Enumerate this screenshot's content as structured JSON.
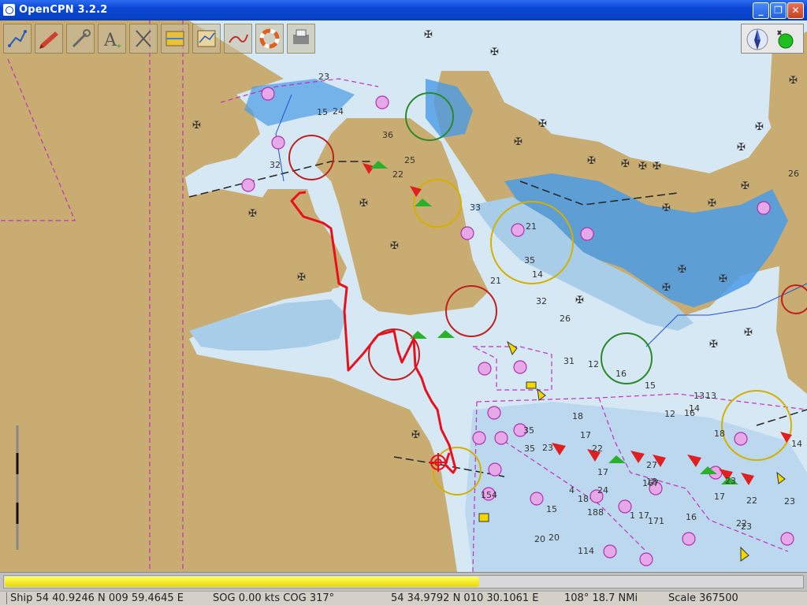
{
  "window": {
    "title": "OpenCPN 3.2.2",
    "minimize_label": "_",
    "maximize_label": "❐",
    "close_label": "✕"
  },
  "toolbar": {
    "buttons": [
      {
        "icon": "route-icon"
      },
      {
        "icon": "ship-icon"
      },
      {
        "icon": "settings-wrench-icon"
      },
      {
        "icon": "text-annotation-icon"
      },
      {
        "icon": "clear-track-icon"
      },
      {
        "icon": "layers-icon"
      },
      {
        "icon": "chart-quilt-icon"
      },
      {
        "icon": "track-icon"
      },
      {
        "icon": "lifebuoy-icon"
      },
      {
        "icon": "print-icon"
      }
    ]
  },
  "compass": {
    "north_icon": "compass-north-icon",
    "gps_status": "gps-ok-icon",
    "gps_color": "#1fbf1f"
  },
  "progress": {
    "fraction": 0.595
  },
  "status": {
    "ship": "Ship 54 40.9246 N   009 59.4645 E",
    "sog_cog": "SOG 0.00 kts   COG 317°",
    "cursor": "54 34.9792 N   010 30.1061 E",
    "bearing_dist": "108°  18.7 NMi",
    "scale": "Scale 367500"
  },
  "chart_labels": {
    "soundings": [
      "23",
      "15",
      "24",
      "36",
      "32",
      "25",
      "22",
      "33",
      "21",
      "35",
      "14",
      "32",
      "26",
      "31",
      "12",
      "16",
      "15",
      "13",
      "16",
      "12",
      "18",
      "17",
      "20",
      "35",
      "23",
      "154",
      "35",
      "22",
      "17",
      "24",
      "18",
      "15",
      "188",
      "17",
      "18",
      "171",
      "16",
      "22",
      "23",
      "20",
      "114",
      "4",
      "1",
      "27",
      "14",
      "13",
      "18",
      "167",
      "17",
      "22",
      "23",
      "14",
      "23",
      "26",
      "21"
    ]
  },
  "colors": {
    "land": "#c8ac72",
    "shallow_water": "#4a9be6",
    "mid_water": "#a8cde9",
    "deep_water": "#d6e8f4",
    "track": "#e8101c",
    "restricted": "#c030c0"
  }
}
